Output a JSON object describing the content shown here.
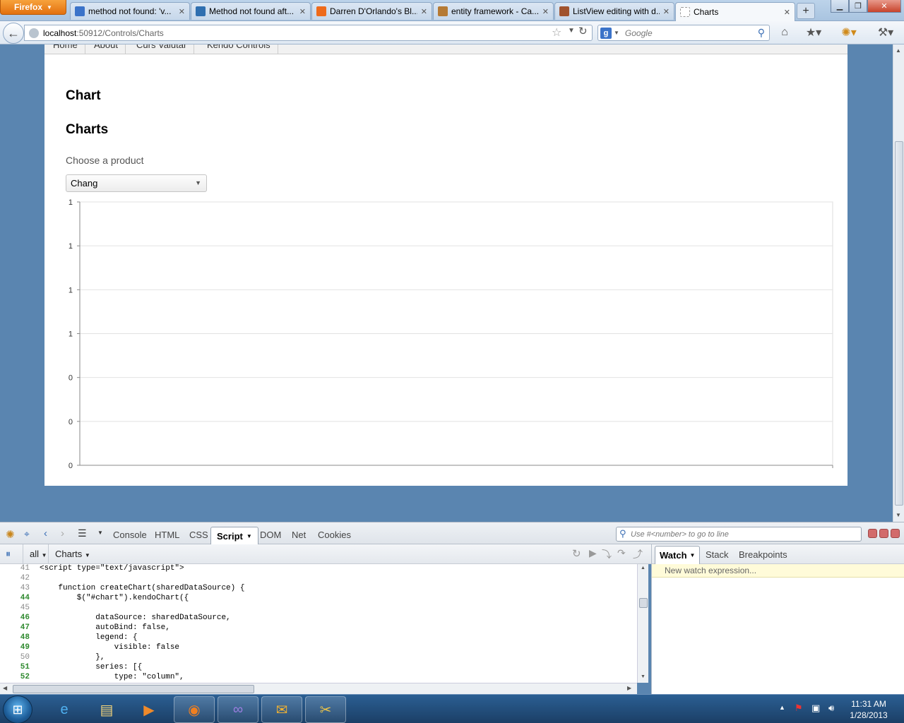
{
  "browser": {
    "menu_button": "Firefox",
    "tabs": [
      {
        "title": "method not found: 'v...",
        "icon": "google-icon",
        "color": "#3b73c9"
      },
      {
        "title": "Method not found aft...",
        "icon": "aspnet-icon",
        "color": "#2f6fb0"
      },
      {
        "title": "Darren D'Orlando's Bl...",
        "icon": "blogger-icon",
        "color": "#ee6a1b"
      },
      {
        "title": "entity framework - Ca...",
        "icon": "stackoverflow-icon",
        "color": "#b57a34"
      },
      {
        "title": "ListView editing with d...",
        "icon": "kendo-icon",
        "color": "#a0522d"
      },
      {
        "title": "Charts",
        "icon": "blank-page-icon",
        "color": "#ffffff"
      }
    ],
    "url_host": "localhost",
    "url_path": ":50912/Controls/Charts",
    "search_placeholder": "Google"
  },
  "page": {
    "menu": [
      "Home",
      "About",
      "Curs Valutar",
      "Kendo Controls"
    ],
    "heading1": "Chart",
    "heading2": "Charts",
    "choose_label": "Choose a product",
    "selected_product": "Chang"
  },
  "chart_data": {
    "type": "bar",
    "categories": [],
    "values": [],
    "y_tick_labels": [
      "1",
      "1",
      "1",
      "1",
      "0",
      "0",
      "0"
    ],
    "ylim": [
      0,
      1
    ],
    "grid": true,
    "legend": "hidden",
    "title": "",
    "xlabel": "",
    "ylabel": ""
  },
  "firebug": {
    "panels": [
      "Console",
      "HTML",
      "CSS",
      "Script",
      "DOM",
      "Net",
      "Cookies"
    ],
    "active_panel": "Script",
    "search_placeholder": "Use #<number> to go to line",
    "filter": "all",
    "file": "Charts",
    "side_tabs": [
      "Watch",
      "Stack",
      "Breakpoints"
    ],
    "new_watch": "New watch expression...",
    "code": [
      {
        "n": "41",
        "exec": false,
        "text": "<script type=\"text/javascript\">"
      },
      {
        "n": "42",
        "exec": false,
        "text": ""
      },
      {
        "n": "43",
        "exec": false,
        "text": "    function createChart(sharedDataSource) {"
      },
      {
        "n": "44",
        "exec": true,
        "text": "        $(\"#chart\").kendoChart({"
      },
      {
        "n": "45",
        "exec": false,
        "text": ""
      },
      {
        "n": "46",
        "exec": true,
        "text": "            dataSource: sharedDataSource,"
      },
      {
        "n": "47",
        "exec": true,
        "text": "            autoBind: false,"
      },
      {
        "n": "48",
        "exec": true,
        "text": "            legend: {"
      },
      {
        "n": "49",
        "exec": true,
        "text": "                visible: false"
      },
      {
        "n": "50",
        "exec": false,
        "text": "            },"
      },
      {
        "n": "51",
        "exec": true,
        "text": "            series: [{"
      },
      {
        "n": "52",
        "exec": true,
        "text": "                type: \"column\","
      }
    ]
  },
  "taskbar": {
    "time": "11:31 AM",
    "date": "1/28/2013"
  }
}
